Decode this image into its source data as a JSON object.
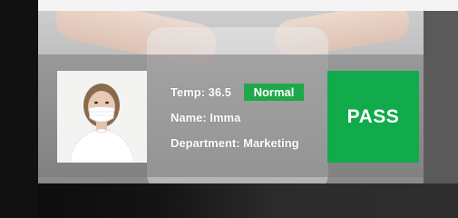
{
  "card": {
    "temp_text": "Temp: 36.5",
    "status_badge": "Normal",
    "name_text": "Name: Imma",
    "department_text": "Department: Marketing",
    "result": "PASS"
  },
  "colors": {
    "badge_green": "#1fa84a",
    "pass_green": "#11ab4c"
  },
  "icons": {
    "photo": "person-with-face-mask-photo"
  }
}
